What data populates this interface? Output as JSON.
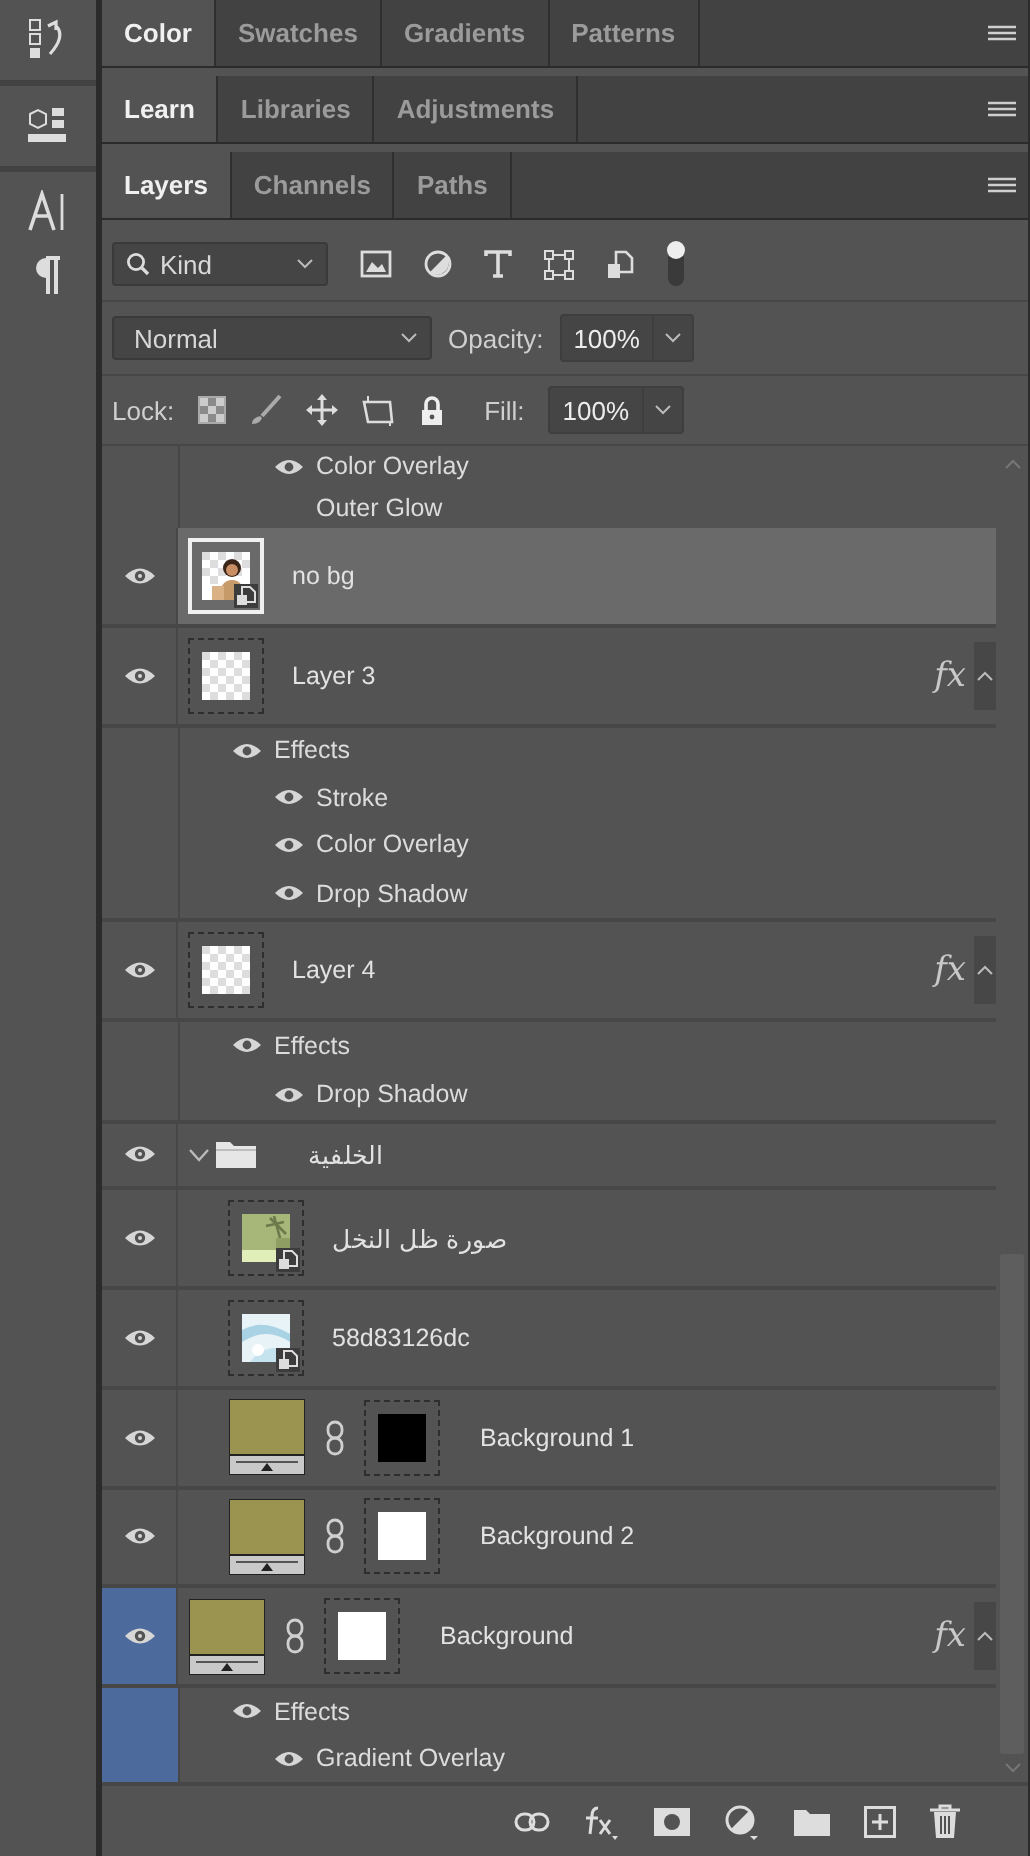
{
  "panels": [
    {
      "tabs": [
        {
          "label": "Color",
          "selected": true
        },
        {
          "label": "Swatches",
          "selected": false
        },
        {
          "label": "Gradients",
          "selected": false
        },
        {
          "label": "Patterns",
          "selected": false
        }
      ]
    },
    {
      "tabs": [
        {
          "label": "Learn",
          "selected": true
        },
        {
          "label": "Libraries",
          "selected": false
        },
        {
          "label": "Adjustments",
          "selected": false
        }
      ]
    },
    {
      "tabs": [
        {
          "label": "Layers",
          "selected": true
        },
        {
          "label": "Channels",
          "selected": false
        },
        {
          "label": "Paths",
          "selected": false
        }
      ]
    }
  ],
  "filter": {
    "value": "Kind"
  },
  "blend_mode": "Normal",
  "opacity": {
    "label": "Opacity:",
    "value": "100%"
  },
  "lock": {
    "label": "Lock:"
  },
  "fill": {
    "label": "Fill:",
    "value": "100%"
  },
  "effects_tail": [
    {
      "name": "Color Overlay",
      "visible": true
    },
    {
      "name": "Outer Glow",
      "visible": false
    }
  ],
  "layers": [
    {
      "name": "no bg",
      "kind": "smart",
      "selected": true,
      "highlighted": false,
      "visible": true
    },
    {
      "name": "Layer 3",
      "kind": "pixel",
      "thumbnail": {
        "kind": "transparent"
      },
      "selected": false,
      "highlighted": false,
      "visible": true,
      "fx": "fx",
      "expanded": true,
      "effects": {
        "label": "Effects",
        "visible": true,
        "items": [
          {
            "name": "Stroke",
            "visible": true
          },
          {
            "name": "Color Overlay",
            "visible": true
          },
          {
            "name": "Drop Shadow",
            "visible": true
          }
        ]
      }
    },
    {
      "name": "Layer 4",
      "kind": "pixel",
      "thumbnail": {
        "kind": "transparent"
      },
      "selected": false,
      "highlighted": false,
      "visible": true,
      "fx": "fx",
      "expanded": true,
      "effects": {
        "label": "Effects",
        "visible": true,
        "items": [
          {
            "name": "Drop Shadow",
            "visible": true
          }
        ]
      }
    },
    {
      "name": "الخلفية",
      "kind": "group",
      "selected": false,
      "highlighted": false,
      "visible": true,
      "expanded": true,
      "children": [
        {
          "name": "صورة ظل النخل",
          "kind": "smart",
          "selected": false,
          "highlighted": false,
          "visible": true
        },
        {
          "name": "58d83126dc",
          "kind": "smart",
          "selected": false,
          "highlighted": false,
          "visible": true
        },
        {
          "name": "Background 1",
          "kind": "fill",
          "mask": {
            "color": "#000000"
          },
          "selected": false,
          "highlighted": false,
          "visible": true
        },
        {
          "name": "Background 2",
          "kind": "fill",
          "mask": {
            "color": "#ffffff"
          },
          "selected": false,
          "highlighted": false,
          "visible": true
        }
      ]
    },
    {
      "name": "Background",
      "kind": "fill",
      "mask": {
        "color": "#ffffff"
      },
      "selected": false,
      "highlighted": true,
      "visible": true,
      "fx": "fx",
      "expanded": true,
      "effects": {
        "label": "Effects",
        "visible": true,
        "items": [
          {
            "name": "Gradient Overlay",
            "visible": true
          }
        ]
      }
    }
  ]
}
